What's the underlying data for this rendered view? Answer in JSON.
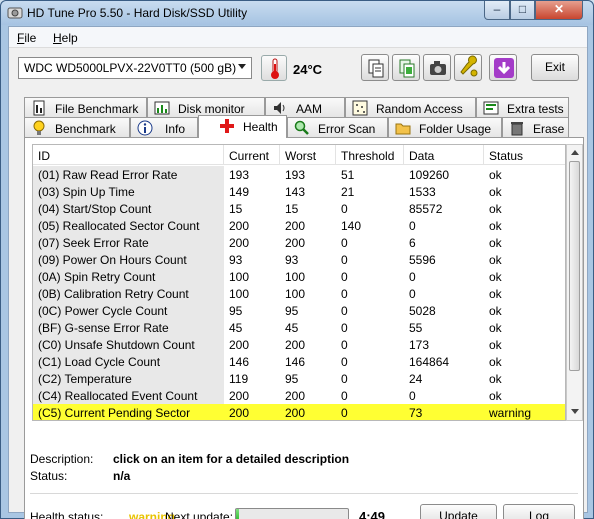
{
  "window": {
    "title": "HD Tune Pro 5.50 - Hard Disk/SSD Utility",
    "minimize": "–",
    "maximize": "□",
    "close": "✕"
  },
  "menu": {
    "file": {
      "u": "F",
      "rest": "ile"
    },
    "help": {
      "u": "H",
      "rest": "elp"
    }
  },
  "toolbar": {
    "drive": "WDC WD5000LPVX-22V0TT0 (500 gB)",
    "temperature": "24°C",
    "exit_label": "Exit"
  },
  "tabs_top": [
    {
      "label": "File Benchmark",
      "icon": "file-benchmark-icon"
    },
    {
      "label": "Disk monitor",
      "icon": "disk-monitor-icon"
    },
    {
      "label": "AAM",
      "icon": "speaker-icon"
    },
    {
      "label": "Random Access",
      "icon": "random-access-icon"
    },
    {
      "label": "Extra tests",
      "icon": "extra-tests-icon"
    }
  ],
  "tabs_bottom": [
    {
      "label": "Benchmark",
      "icon": "lightbulb-icon"
    },
    {
      "label": "Info",
      "icon": "info-icon"
    },
    {
      "label": "Health",
      "icon": "health-cross-icon"
    },
    {
      "label": "Error Scan",
      "icon": "magnifier-icon"
    },
    {
      "label": "Folder Usage",
      "icon": "folder-icon"
    },
    {
      "label": "Erase",
      "icon": "trash-icon"
    }
  ],
  "table": {
    "headers": [
      "ID",
      "Current",
      "Worst",
      "Threshold",
      "Data",
      "Status"
    ],
    "rows": [
      {
        "id": "(01) Raw Read Error Rate",
        "current": "193",
        "worst": "193",
        "threshold": "51",
        "data": "109260",
        "status": "ok"
      },
      {
        "id": "(03) Spin Up Time",
        "current": "149",
        "worst": "143",
        "threshold": "21",
        "data": "1533",
        "status": "ok"
      },
      {
        "id": "(04) Start/Stop Count",
        "current": "15",
        "worst": "15",
        "threshold": "0",
        "data": "85572",
        "status": "ok"
      },
      {
        "id": "(05) Reallocated Sector Count",
        "current": "200",
        "worst": "200",
        "threshold": "140",
        "data": "0",
        "status": "ok"
      },
      {
        "id": "(07) Seek Error Rate",
        "current": "200",
        "worst": "200",
        "threshold": "0",
        "data": "6",
        "status": "ok"
      },
      {
        "id": "(09) Power On Hours Count",
        "current": "93",
        "worst": "93",
        "threshold": "0",
        "data": "5596",
        "status": "ok"
      },
      {
        "id": "(0A) Spin Retry Count",
        "current": "100",
        "worst": "100",
        "threshold": "0",
        "data": "0",
        "status": "ok"
      },
      {
        "id": "(0B) Calibration Retry Count",
        "current": "100",
        "worst": "100",
        "threshold": "0",
        "data": "0",
        "status": "ok"
      },
      {
        "id": "(0C) Power Cycle Count",
        "current": "95",
        "worst": "95",
        "threshold": "0",
        "data": "5028",
        "status": "ok"
      },
      {
        "id": "(BF) G-sense Error Rate",
        "current": "45",
        "worst": "45",
        "threshold": "0",
        "data": "55",
        "status": "ok"
      },
      {
        "id": "(C0) Unsafe Shutdown Count",
        "current": "200",
        "worst": "200",
        "threshold": "0",
        "data": "173",
        "status": "ok"
      },
      {
        "id": "(C1) Load Cycle Count",
        "current": "146",
        "worst": "146",
        "threshold": "0",
        "data": "164864",
        "status": "ok"
      },
      {
        "id": "(C2) Temperature",
        "current": "119",
        "worst": "95",
        "threshold": "0",
        "data": "24",
        "status": "ok"
      },
      {
        "id": "(C4) Reallocated Event Count",
        "current": "200",
        "worst": "200",
        "threshold": "0",
        "data": "0",
        "status": "ok"
      },
      {
        "id": "(C5) Current Pending Sector",
        "current": "200",
        "worst": "200",
        "threshold": "0",
        "data": "73",
        "status": "warning"
      }
    ]
  },
  "details": {
    "description_label": "Description:",
    "description_value": "click on an item for a detailed description",
    "status_label": "Status:",
    "status_value": "n/a"
  },
  "footer": {
    "health_label": "Health status:",
    "health_value": "warning",
    "next_update_label": "Next update:",
    "next_update_progress": 0.03,
    "timer": "4:49",
    "update_label": "Update",
    "log_label": "Log"
  },
  "colors": {
    "warning_row": "#ffff33",
    "warning_text": "#e8c300"
  }
}
